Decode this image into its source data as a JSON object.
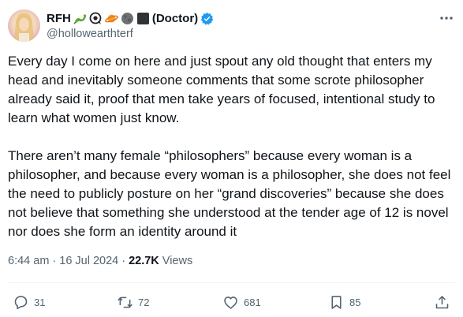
{
  "author": {
    "display_name": "RFH",
    "credential": "(Doctor)",
    "handle": "@hollowearthterf",
    "name_emojis": [
      "dragon",
      "eye-speech",
      "planet-ring",
      "new-moon",
      "black-square"
    ],
    "verified": true
  },
  "tweet": {
    "paragraphs": [
      "Every day I come on here and just spout any old thought that enters my head and inevitably someone comments that some scrote philosopher already said it, proof that men take years of focused, intentional study to learn what women just know.",
      "There aren’t many female “philosophers” because every woman is a philosopher, and because every woman is a philosopher, she does not feel the need to publicly posture on her “grand discoveries” because she does not believe that something she understood at the tender age of 12 is novel nor does she form an identity around it"
    ],
    "time": "6:44 am",
    "separator": "·",
    "date": "16 Jul 2024",
    "views_count": "22.7K",
    "views_label": "Views"
  },
  "actions": {
    "replies": "31",
    "reposts": "72",
    "likes": "681",
    "bookmarks": "85"
  },
  "colors": {
    "text": "#0f1419",
    "secondary": "#536471",
    "verified": "#1d9bf0",
    "divider": "#eff3f4"
  }
}
